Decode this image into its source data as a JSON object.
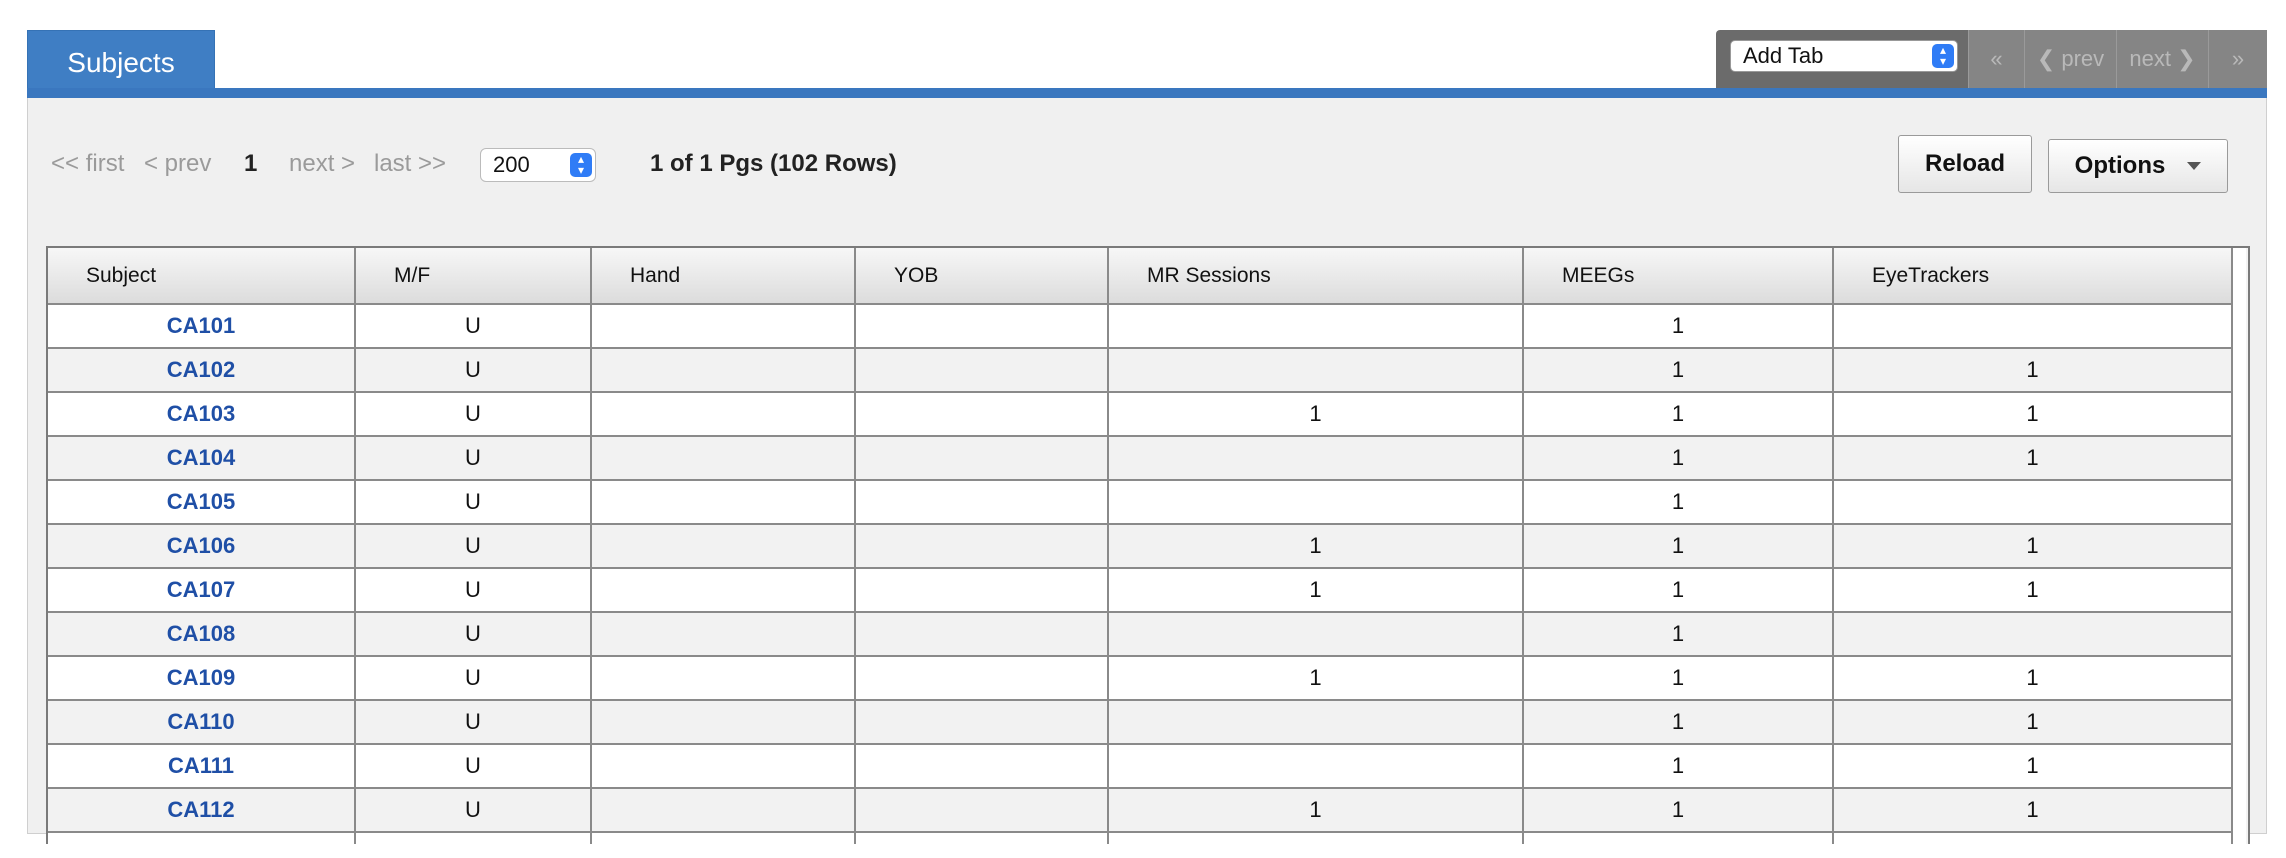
{
  "tab": {
    "label": "Subjects"
  },
  "tab_nav": {
    "add_tab": "Add Tab",
    "first": "«",
    "prev": "❮ prev",
    "next": "next ❯",
    "last": "»"
  },
  "pager": {
    "first": "<< first",
    "prev": "< prev",
    "current": "1",
    "next": "next >",
    "last": "last >>",
    "rows_per_page": "200",
    "summary": "1 of 1 Pgs (102 Rows)"
  },
  "buttons": {
    "reload": "Reload",
    "options": "Options"
  },
  "table": {
    "columns": [
      "Subject",
      "M/F",
      "Hand",
      "YOB",
      "MR Sessions",
      "MEEGs",
      "EyeTrackers"
    ],
    "rows": [
      [
        "CA101",
        "U",
        "",
        "",
        "",
        "1",
        ""
      ],
      [
        "CA102",
        "U",
        "",
        "",
        "",
        "1",
        "1"
      ],
      [
        "CA103",
        "U",
        "",
        "",
        "1",
        "1",
        "1"
      ],
      [
        "CA104",
        "U",
        "",
        "",
        "",
        "1",
        "1"
      ],
      [
        "CA105",
        "U",
        "",
        "",
        "",
        "1",
        ""
      ],
      [
        "CA106",
        "U",
        "",
        "",
        "1",
        "1",
        "1"
      ],
      [
        "CA107",
        "U",
        "",
        "",
        "1",
        "1",
        "1"
      ],
      [
        "CA108",
        "U",
        "",
        "",
        "",
        "1",
        ""
      ],
      [
        "CA109",
        "U",
        "",
        "",
        "1",
        "1",
        "1"
      ],
      [
        "CA110",
        "U",
        "",
        "",
        "",
        "1",
        "1"
      ],
      [
        "CA111",
        "U",
        "",
        "",
        "",
        "1",
        "1"
      ],
      [
        "CA112",
        "U",
        "",
        "",
        "1",
        "1",
        "1"
      ],
      [
        "",
        "",
        "",
        "",
        "",
        "",
        ""
      ]
    ]
  }
}
